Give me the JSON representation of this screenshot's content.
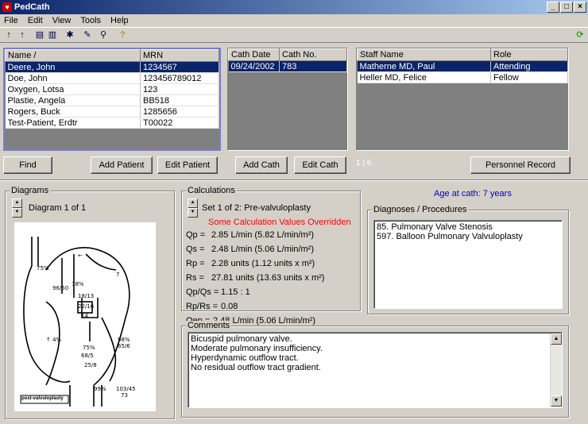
{
  "window": {
    "title": "PedCath",
    "minimize": "_",
    "maximize": "□",
    "close": "×"
  },
  "menu": [
    "File",
    "Edit",
    "View",
    "Tools",
    "Help"
  ],
  "patients": {
    "columns": [
      "Name",
      "MRN"
    ],
    "sort_indicator": "/",
    "rows": [
      {
        "name": "Deere, John",
        "mrn": "1234567"
      },
      {
        "name": "Doe, John",
        "mrn": "123456789012"
      },
      {
        "name": "Oxygen, Lotsa",
        "mrn": "123"
      },
      {
        "name": "Plastie, Angela",
        "mrn": "BB518"
      },
      {
        "name": "Rogers, Buck",
        "mrn": "1285656"
      },
      {
        "name": "Test-Patient, Erdtr",
        "mrn": "T00022"
      }
    ]
  },
  "caths": {
    "columns": [
      "Cath Date",
      "Cath No."
    ],
    "rows": [
      {
        "date": "09/24/2002",
        "no": "783"
      }
    ]
  },
  "staff": {
    "columns": [
      "Staff Name",
      "Role"
    ],
    "rows": [
      {
        "name": "Matherne MD, Paul",
        "role": "Attending"
      },
      {
        "name": "Heller MD, Felice",
        "role": "Fellow"
      }
    ]
  },
  "buttons": {
    "find": "Find",
    "add_patient": "Add Patient",
    "edit_patient": "Edit Patient",
    "add_cath": "Add Cath",
    "edit_cath": "Edit Cath",
    "personnel": "Personnel Record",
    "counter": "1 | 6"
  },
  "diagrams": {
    "label": "Diagrams",
    "counter": "Diagram 1 of 1",
    "caption": "post-valvuloplasty"
  },
  "calculations": {
    "label": "Calculations",
    "set": "Set 1 of 2: Pre-valvuloplasty",
    "warning": "Some Calculation Values Overridden",
    "rows": [
      {
        "k": "Qp =",
        "v": "2.85 L/min (5.82 L/min/m²)"
      },
      {
        "k": "Qs =",
        "v": "2.48 L/min (5.06 L/min/m²)"
      },
      {
        "k": "Rp =",
        "v": "2.28 units (1.12 units x m²)"
      },
      {
        "k": "Rs =",
        "v": "27.81 units (13.63 units x m²)"
      },
      {
        "k": "Qp/Qs =",
        "v": "1.15 : 1"
      },
      {
        "k": "Rp/Rs =",
        "v": "0.08"
      },
      {
        "k": "Qep =",
        "v": "2.48 L/min (5.06 L/min/m²)"
      }
    ]
  },
  "age": "Age at cath: 7 years",
  "diagnoses": {
    "label": "Diagnoses / Procedures",
    "items": [
      "85. Pulmonary Valve Stenosis",
      "597. Balloon Pulmonary Valvuloplasty"
    ]
  },
  "comments": {
    "label": "Comments",
    "lines": [
      "Bicuspid pulmonary valve.",
      "Moderate pulmonary insufficiency.",
      "Hyperdynamic outflow tract.",
      "No residual outflow tract gradient."
    ]
  },
  "colors": {
    "selection": "#0a246a",
    "warning": "#ff0000",
    "age": "#0000cc"
  }
}
